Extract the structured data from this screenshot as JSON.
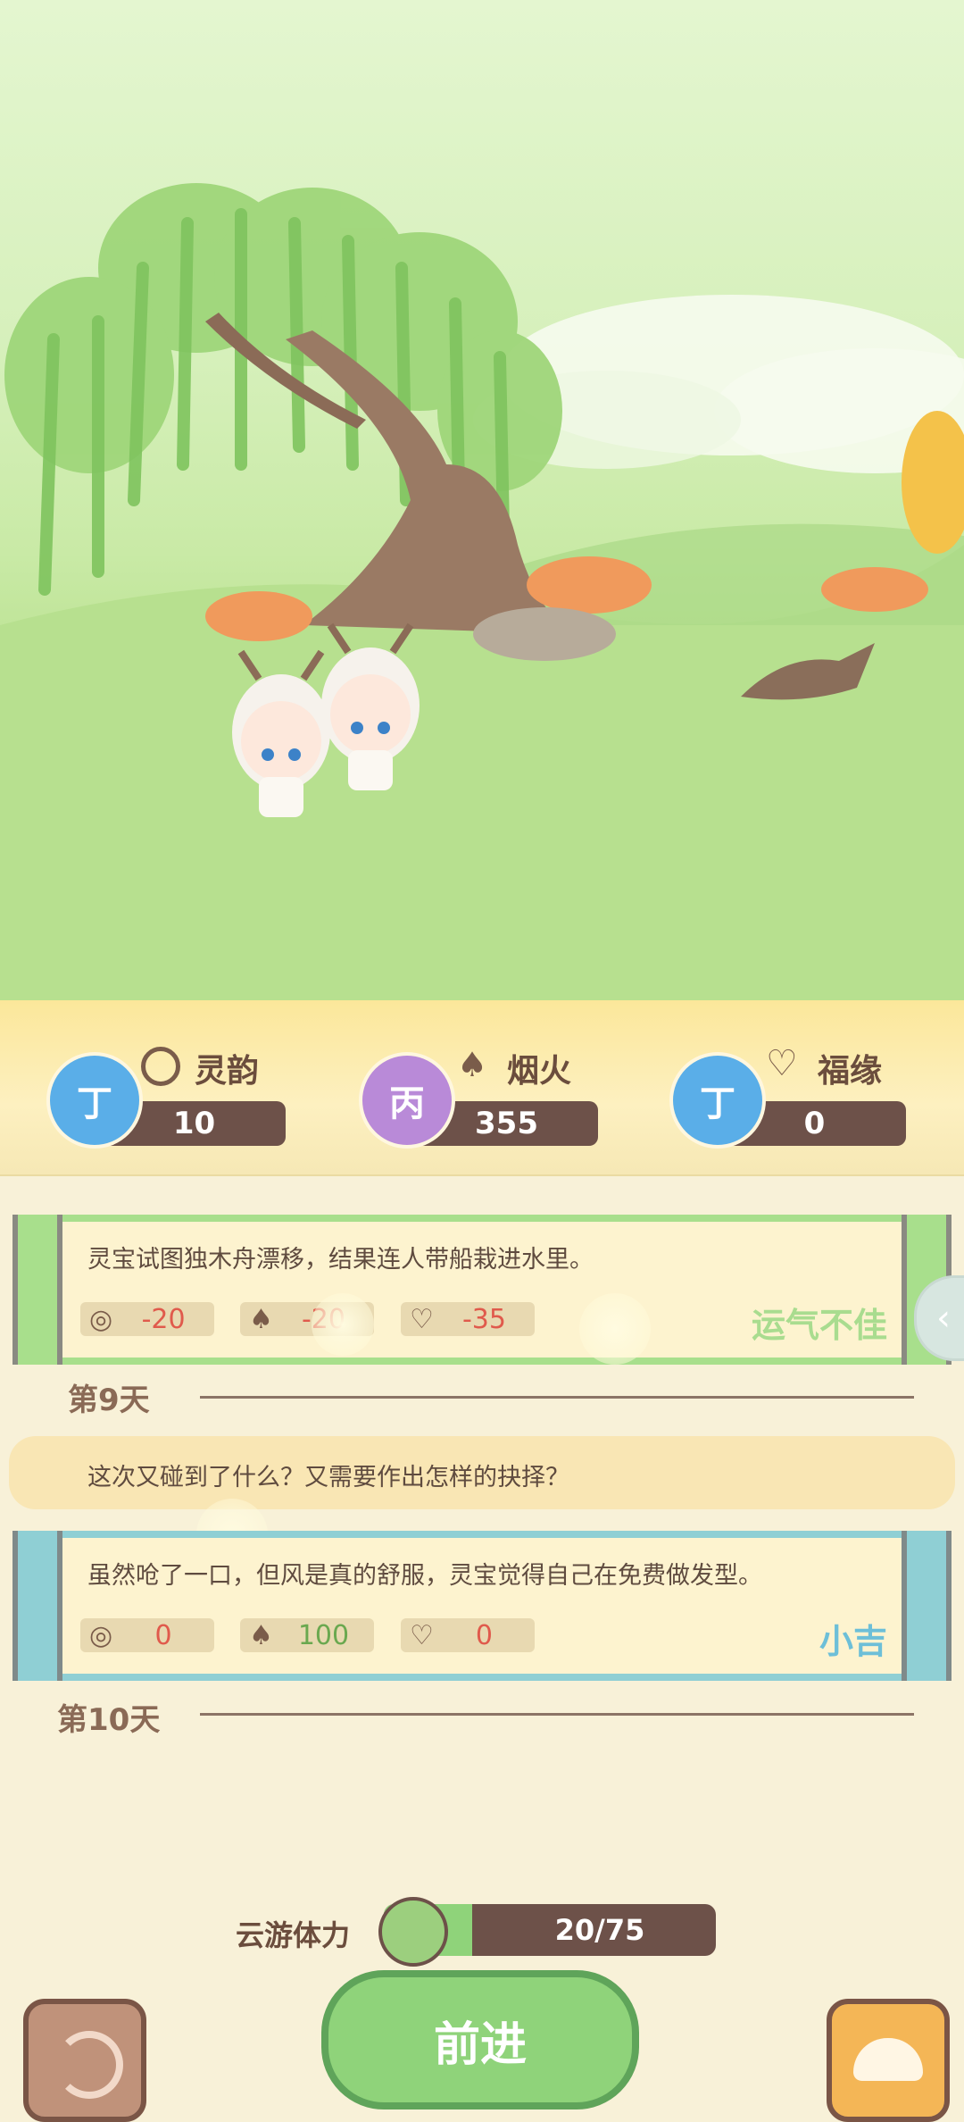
{
  "stats": [
    {
      "coin_char": "丁",
      "label": "灵韵",
      "value": "10",
      "icon": "spiral-icon",
      "coin_color": "#5aaee8"
    },
    {
      "coin_char": "丙",
      "label": "烟火",
      "value": "355",
      "icon": "mushroom-icon",
      "coin_color": "#b98ad8"
    },
    {
      "coin_char": "丁",
      "label": "福缘",
      "value": "0",
      "icon": "heart-knot-icon",
      "coin_color": "#5aaee8"
    }
  ],
  "event1": {
    "text": "灵宝试图独木舟漂移，结果连人带船栽进水里。",
    "values": [
      "-20",
      "-20",
      "-35"
    ],
    "result": "运气不佳"
  },
  "day9": {
    "label": "第9天"
  },
  "prompt": {
    "text": "这次又碰到了什么？又需要作出怎样的抉择？"
  },
  "event2": {
    "text": "虽然呛了一口，但风是真的舒服，灵宝觉得自己在免费做发型。",
    "values": [
      "0",
      "100",
      "0"
    ],
    "result": "小吉"
  },
  "day10": {
    "label": "第10天"
  },
  "stamina": {
    "label": "云游体力",
    "value": "20/75",
    "current": 20,
    "max": 75
  },
  "advance_button": {
    "label": "前进"
  },
  "colors": {
    "negative": "#e05a4c",
    "positive": "#6aa84f",
    "neutral": "#e05a4c",
    "result_bad": "#a9dc8f",
    "result_good": "#6dbfd8"
  }
}
